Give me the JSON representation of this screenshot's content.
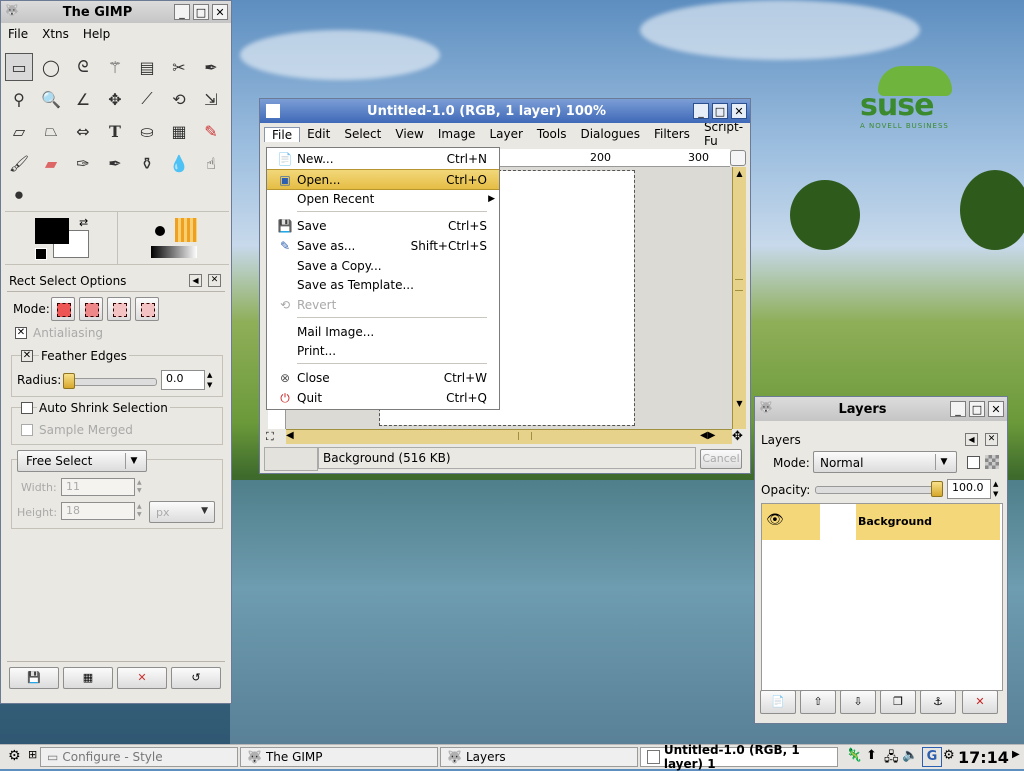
{
  "desktop": {
    "logo_text": "suse",
    "logo_sub": "A NOVELL BUSINESS"
  },
  "toolbox": {
    "title": "The GIMP",
    "menu": [
      "File",
      "Xtns",
      "Help"
    ],
    "options_title": "Rect Select Options",
    "mode_label": "Mode:",
    "antialiasing": "Antialiasing",
    "feather_edges": "Feather Edges",
    "radius_label": "Radius:",
    "radius_value": "0.0",
    "auto_shrink": "Auto Shrink Selection",
    "sample_merged": "Sample Merged",
    "free_select": "Free Select",
    "width_label": "Width:",
    "width_value": "11",
    "height_label": "Height:",
    "height_value": "18",
    "unit": "px"
  },
  "image_window": {
    "title": "Untitled-1.0 (RGB, 1 layer) 100%",
    "menu": [
      "File",
      "Edit",
      "Select",
      "View",
      "Image",
      "Layer",
      "Tools",
      "Dialogues",
      "Filters",
      "Script-Fu"
    ],
    "ruler_200": "200",
    "ruler_300": "300",
    "status": "Background (516 KB)",
    "cancel": "Cancel"
  },
  "file_menu": {
    "items": [
      {
        "label": "New...",
        "accel": "Ctrl+N"
      },
      {
        "label": "Open...",
        "accel": "Ctrl+O"
      },
      {
        "label": "Open Recent",
        "accel": ""
      },
      {
        "label": "Save",
        "accel": "Ctrl+S"
      },
      {
        "label": "Save as...",
        "accel": "Shift+Ctrl+S"
      },
      {
        "label": "Save a Copy...",
        "accel": ""
      },
      {
        "label": "Save as Template...",
        "accel": ""
      },
      {
        "label": "Revert",
        "accel": ""
      },
      {
        "label": "Mail Image...",
        "accel": ""
      },
      {
        "label": "Print...",
        "accel": ""
      },
      {
        "label": "Close",
        "accel": "Ctrl+W"
      },
      {
        "label": "Quit",
        "accel": "Ctrl+Q"
      }
    ]
  },
  "layers": {
    "title": "Layers",
    "header": "Layers",
    "mode_label": "Mode:",
    "mode_value": "Normal",
    "opacity_label": "Opacity:",
    "opacity_value": "100.0",
    "opacity_fraction": 1.0,
    "layer_name": "Background"
  },
  "taskbar": {
    "tasks": [
      {
        "label": "Configure - Style"
      },
      {
        "label": "The GIMP"
      },
      {
        "label": "Layers"
      },
      {
        "label": "Untitled-1.0 (RGB, 1 layer) 1"
      }
    ],
    "clock": "17:14"
  }
}
